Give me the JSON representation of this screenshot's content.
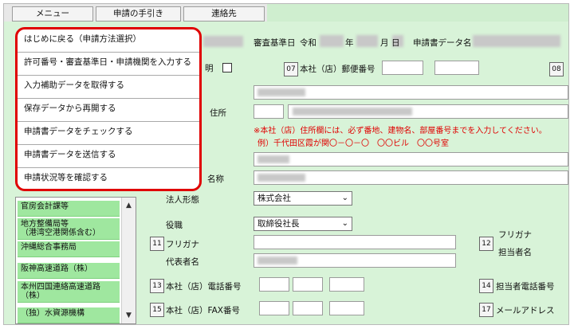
{
  "tabs": [
    "メニュー",
    "申請の手引き",
    "連絡先"
  ],
  "menu": {
    "items": [
      "はじめに戻る（申請方法選択）",
      "許可番号・審査基準日・申請機関を入力する",
      "入力補助データを取得する",
      "保存データから再開する",
      "申請書データをチェックする",
      "申請書データを送信する",
      "申請状況等を確認する"
    ]
  },
  "header": {
    "review_date_label": "審査基準日",
    "era": "令和",
    "year_unit": "年",
    "month_unit": "月",
    "day_unit": "日",
    "app_data_name_label": "申請書データ名"
  },
  "form": {
    "partial_text_1": "明",
    "num_07": "07",
    "postal_label": "本社（店）郵便番号",
    "num_08": "08",
    "address_label": "住所",
    "note_line1": "※本社（店）住所欄には、必ず番地、建物名、部屋番号までを入力してください。",
    "note_line2": "例）千代田区霞が関〇－〇－〇　〇〇ビル　〇〇号室",
    "partial_text_2": "名称",
    "corp_type_label": "法人形態",
    "corp_type_value": "株式会社",
    "position_label": "役職",
    "position_value": "取締役社長",
    "num_11": "11",
    "furigana_label": "フリガナ",
    "rep_name_label": "代表者名",
    "num_12": "12",
    "furigana_label_2": "フリガナ",
    "contact_person_label": "担当者名",
    "num_13": "13",
    "tel_label": "本社（店）電話番号",
    "num_14": "14",
    "contact_tel_label": "担当者電話番号",
    "num_15": "15",
    "fax_label": "本社（店）FAX番号",
    "num_17": "17",
    "email_label": "メールアドレス"
  },
  "agency_list": {
    "items": [
      "官房会計課等",
      "地方整備局等\n（港湾空港関係含む）",
      "沖縄総合事務局",
      "阪神高速道路（株）",
      "本州四国連絡高速道路\n（株）",
      "（独）水資源機構"
    ]
  },
  "icons": {
    "scroll_up": "up-arrow",
    "scroll_down": "down-arrow",
    "select_arrow": "chevron-down"
  },
  "colors": {
    "highlight": "#e00000",
    "background": "#d8f3d8",
    "list_item": "#9fe79f"
  }
}
